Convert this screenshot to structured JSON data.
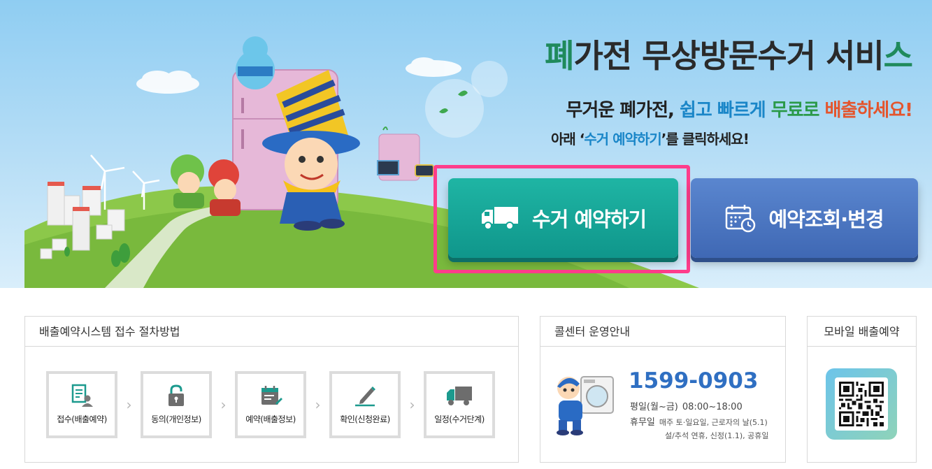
{
  "hero": {
    "title_part1": "폐",
    "title_part2": "가전 무상방문수거 서비",
    "title_part3": "스",
    "sub1_a": "무거운 폐가전, ",
    "sub1_b": "쉽고 빠르게 ",
    "sub1_c": "무료로 ",
    "sub1_d": "배출하세요!",
    "sub2_a": "아래 ‘",
    "sub2_b": "수거 예약하기",
    "sub2_c": "’를 클릭하세요!"
  },
  "buttons": {
    "collect": "수거 예약하기",
    "lookup": "예약조회·변경"
  },
  "steps_panel": {
    "title": "배출예약시스템 접수 절차방법",
    "steps": [
      {
        "label": "접수(배출예약)"
      },
      {
        "label": "동의(개인정보)"
      },
      {
        "label": "예약(배출정보)"
      },
      {
        "label": "확인(신청완료)"
      },
      {
        "label": "일정(수거단계)"
      }
    ]
  },
  "call_panel": {
    "title": "콜센터 운영안내",
    "phone": "1599-0903",
    "weekday_label": "평일(월~금)",
    "weekday_hours": "08:00~18:00",
    "holiday_label": "휴무일",
    "holiday_line1": "매주 토·일요일, 근로자의 날(5.1)",
    "holiday_line2": "설/추석 연휴, 신정(1.1), 공휴일"
  },
  "mobile_panel": {
    "title": "모바일 배출예약"
  },
  "colors": {
    "collect_button": "#12a396",
    "lookup_button": "#4a74c0",
    "highlight": "#ff3d8b",
    "phone": "#2f6fc2"
  }
}
